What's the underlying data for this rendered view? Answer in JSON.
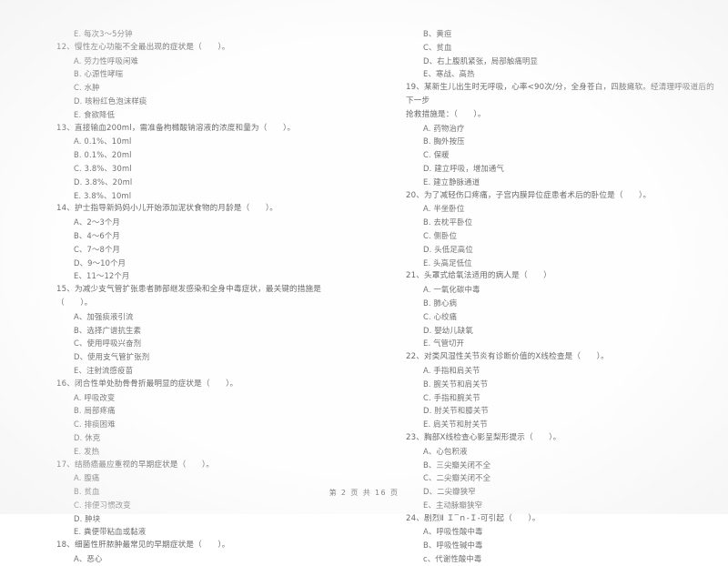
{
  "document": {
    "type": "scanned-exam-paper",
    "language": "zh-CN",
    "footer": "第 2 页 共 16 页"
  },
  "left_column": {
    "orphan_option": "E. 每次3～5分钟",
    "questions": [
      {
        "number": "12",
        "stem": "12、慢性左心功能不全最出现的症状是（　　）。",
        "options": [
          "A. 劳力性呼吸闲难",
          "B. 心源性哮喘",
          "C. 水肿",
          "D. 咳粉红色泡沫样痰",
          "E. 食欲降低"
        ]
      },
      {
        "number": "13",
        "stem": "13、直接输血200ml，需准备枸橼酸钠溶液的浓度和量为（　　）。",
        "options": [
          "A. 0.1%、10ml",
          "B. 0.1%、20ml",
          "C. 3.8%、30ml",
          "D. 3.8%、20ml",
          "E. 3.8%、10ml"
        ]
      },
      {
        "number": "14",
        "stem": "14、护士指导新妈妈小儿开始添加泥状食物的月龄是（　　）。",
        "options": [
          "A、2～3个月",
          "B、4～6个月",
          "C、7～8个月",
          "D、9～10个月",
          "E、11～12个月"
        ]
      },
      {
        "number": "15",
        "stem": "15、为减少支气管扩张患者肺部继发感染和全身中毒症状，最关键的措施是（　　）。",
        "options": [
          "A、加强痰液引流",
          "B、选择广谱抗生素",
          "C、使用呼吸兴奋剂",
          "D、使用支气管扩张剂",
          "E、注射流感疫苗"
        ]
      },
      {
        "number": "16",
        "stem": "16、闭合性单处肋骨骨折最明显的症状是（　　）。",
        "options": [
          "A. 呼吸改变",
          "B. 局部疼痛",
          "C. 排痰困难",
          "D. 休克",
          "E. 发热"
        ]
      },
      {
        "number": "17",
        "stem": "17、结肠癌最应重视的早期症状是（　　）。",
        "options": [
          "A. 腹痛",
          "B. 贫血",
          "C. 排便习惯改变",
          "D. 肿块",
          "E. 粪便带粘血或黏液"
        ]
      },
      {
        "number": "18",
        "stem": "18、细菌性肝脓肿最常见的早期症状是（　　）。",
        "options": [
          "A、恶心"
        ]
      }
    ]
  },
  "right_column": {
    "orphan_options": [
      "B、黄疸",
      "C、贫血",
      "D、右上腹肌紧张，局部触痛明显",
      "E、寒战、高热"
    ],
    "questions": [
      {
        "number": "19",
        "stem": "19、某新生儿出生时无呼吸，心率<90次/分，全身苍白，四肢瘫软。经清理呼吸道后的下一步",
        "stem_line2": "抢救措施是：（　　）。",
        "options": [
          "A. 药物治疗",
          "B. 胸外按压",
          "C. 保暖",
          "D. 建立呼吸，增加通气",
          "E. 建立静脉通道"
        ]
      },
      {
        "number": "20",
        "stem": "20、为了减轻伤口疼痛，子宫内膜异位症患者术后的卧位是（　　）。",
        "options": [
          "A. 半坐卧位",
          "B. 去枕平卧位",
          "C. 侧卧位",
          "D. 头低足高位",
          "E. 头高足低位"
        ]
      },
      {
        "number": "21",
        "stem": "21、头罩式给氧法适用的病人是（　　）",
        "options": [
          "A. 一氧化碳中毒",
          "B. 肺心病",
          "C. 心绞痛",
          "D. 婴幼儿缺氧",
          "E. 气管切开"
        ]
      },
      {
        "number": "22",
        "stem": "22、对类风湿性关节炎有诊断价值的X线检查是（　　）。",
        "options": [
          "A. 手指和肩关节",
          "B. 腕关节和肩关节",
          "C. 手指和腕关节",
          "D. 肘关节和膝关节",
          "E. 肩关节和肘关节"
        ]
      },
      {
        "number": "23",
        "stem": "23、胸部X线检查心影呈梨形提示（　　）。",
        "options": [
          "A、心包积液",
          "B、三尖瓣关闭不全",
          "C、二尖瓣关闭不全",
          "D、二尖瓣狭窄",
          "E、主动脉瓣狭窄"
        ]
      },
      {
        "number": "24",
        "stem": "24、剧烈Ⅱ Ｉ‾ｎ-Ｉ-可引起（　　）。",
        "options": [
          "A、呼吸性酸中毒",
          "B、呼吸性碱中毒",
          "c、代谢性酸中毒"
        ]
      }
    ]
  }
}
